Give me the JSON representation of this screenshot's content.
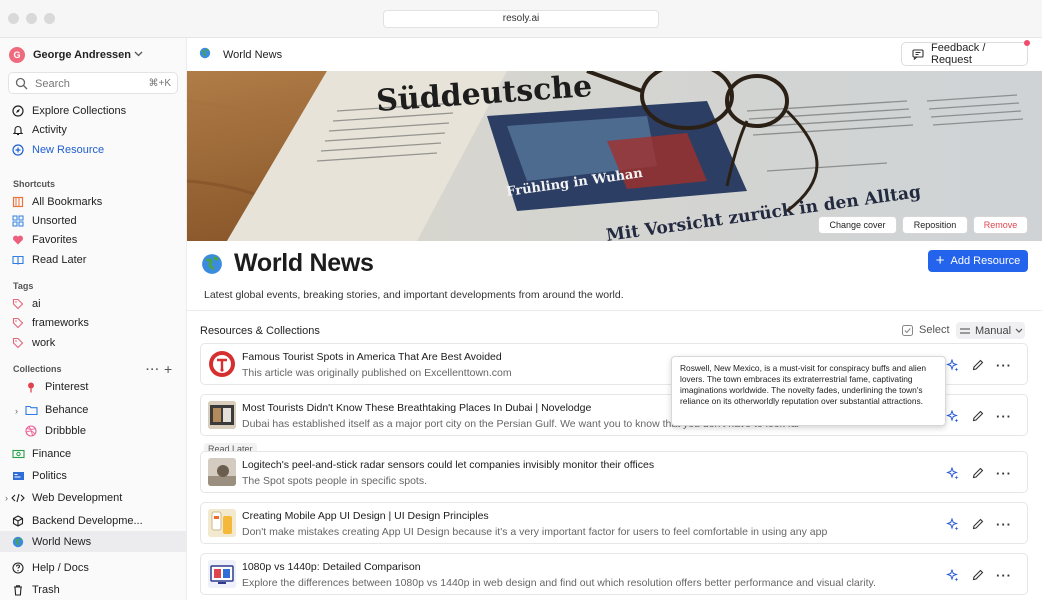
{
  "window": {
    "url": "resoly.ai"
  },
  "sidebar": {
    "user_name": "George Andressen",
    "user_initial": "G",
    "search_placeholder": "Search",
    "search_shortcut": "⌘+K",
    "top_nav": [
      {
        "label": "Explore Collections",
        "icon": "compass-icon"
      },
      {
        "label": "Activity",
        "icon": "bell-icon"
      },
      {
        "label": "New Resource",
        "icon": "plus-circle-icon"
      }
    ],
    "shortcuts_label": "Shortcuts",
    "shortcuts": [
      {
        "label": "All Bookmarks",
        "icon": "bookmarks-icon"
      },
      {
        "label": "Unsorted",
        "icon": "grid-icon"
      },
      {
        "label": "Favorites",
        "icon": "heart-icon"
      },
      {
        "label": "Read Later",
        "icon": "book-icon"
      }
    ],
    "tags_label": "Tags",
    "tags": [
      "ai",
      "frameworks",
      "work"
    ],
    "collections_label": "Collections",
    "collections": [
      {
        "label": "Pinterest",
        "icon": "pin-icon"
      },
      {
        "label": "Behance",
        "icon": "folder-icon"
      },
      {
        "label": "Dribbble",
        "icon": "dribbble-icon"
      },
      {
        "label": "Finance",
        "icon": "money-icon"
      },
      {
        "label": "Politics",
        "icon": "politics-icon"
      },
      {
        "label": "Web Development",
        "icon": "code-icon"
      },
      {
        "label": "Backend Developme...",
        "icon": "cube-icon"
      },
      {
        "label": "World News",
        "icon": "globe-icon"
      }
    ],
    "bottom_nav": [
      {
        "label": "Help / Docs",
        "icon": "help-icon"
      },
      {
        "label": "Trash",
        "icon": "trash-icon"
      }
    ]
  },
  "header": {
    "breadcrumb": "World News",
    "feedback_label": "Feedback / Request"
  },
  "cover": {
    "change_label": "Change cover",
    "reposition_label": "Reposition",
    "remove_label": "Remove",
    "newspaper_masthead": "Süddeutsche",
    "newspaper_headline_1": "Frühling in Wuhan",
    "newspaper_headline_2": "Mit Vorsicht zurück in den Alltag"
  },
  "page": {
    "title": "World News",
    "description": "Latest global events, breaking stories, and important developments from around the world.",
    "add_resource_label": "Add Resource",
    "section_label": "Resources & Collections",
    "select_label": "Select",
    "sort_label": "Manual"
  },
  "resources": [
    {
      "title": "Famous Tourist Spots in America That Are Best Avoided",
      "description": "This article was originally published on Excellenttown.com",
      "badge": ""
    },
    {
      "title": "Most Tourists Didn't Know These Breathtaking Places In Dubai | Novelodge",
      "description": "Dubai has established itself as a major port city on the Persian Gulf. We want you to know that you don't have to look far to find an amazing place to",
      "badge": ""
    },
    {
      "title": "Logitech's peel-and-stick radar sensors could let companies invisibly monitor their offices",
      "description": "The Spot spots people in specific spots.",
      "badge": "Read Later"
    },
    {
      "title": "Creating Mobile App UI Design | UI Design Principles",
      "description": "Don't make mistakes creating App UI Design because it's a very important factor for users to feel comfortable in using any app",
      "badge": ""
    },
    {
      "title": "1080p vs 1440p: Detailed Comparison",
      "description": "Explore the differences between 1080p vs 1440p in web design and find out which resolution offers better performance and visual clarity.",
      "badge": ""
    }
  ],
  "tooltip": {
    "text": "Roswell, New Mexico, is a must-visit for conspiracy buffs and alien lovers. The town embraces its extraterrestrial fame, captivating imaginations worldwide. The novelty fades, underlining the town's reliance on its otherworldly reputation over substantial attractions."
  },
  "colors": {
    "accent": "#2463eb",
    "link_blue": "#1f5fd1",
    "remove_red": "#e0454f",
    "avatar_pink": "#f06a7e",
    "sparkle_blue": "#2a5bd7"
  }
}
